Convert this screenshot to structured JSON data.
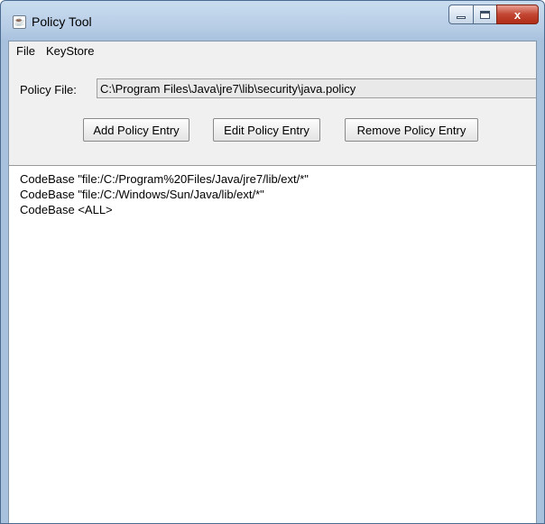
{
  "window": {
    "title": "Policy Tool",
    "close_glyph": "x"
  },
  "menu": {
    "items": [
      "File",
      "KeyStore"
    ]
  },
  "policy_file": {
    "label": "Policy File:",
    "value": "C:\\Program Files\\Java\\jre7\\lib\\security\\java.policy"
  },
  "buttons": {
    "add": "Add Policy Entry",
    "edit": "Edit Policy Entry",
    "remove": "Remove Policy Entry"
  },
  "entries": [
    "CodeBase \"file:/C:/Program%20Files/Java/jre7/lib/ext/*\"",
    "CodeBase \"file:/C:/Windows/Sun/Java/lib/ext/*\"",
    "CodeBase <ALL>"
  ],
  "icons": {
    "app": "java-cup-icon",
    "minimize": "minimize-icon",
    "maximize": "maximize-icon",
    "close": "close-icon"
  }
}
